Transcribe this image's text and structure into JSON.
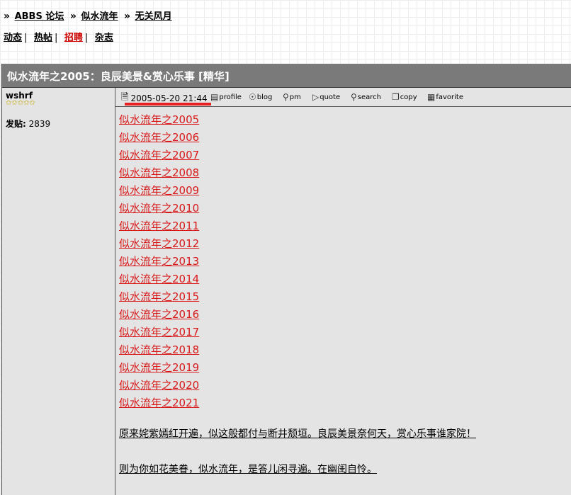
{
  "breadcrumb": {
    "sep": "»",
    "items": [
      "ABBS 论坛",
      "似水流年",
      "无关风月"
    ]
  },
  "topnav": {
    "items": [
      "动态",
      "热帖",
      "招聘",
      "杂志"
    ],
    "pipe": "|"
  },
  "thread": {
    "title": "似水流年之2005：良辰美景&赏心乐事   [精华]"
  },
  "author": {
    "name": "wshrf",
    "stars": "✩✩✩✩✩",
    "post_count_label": "发贴:",
    "post_count": "2839"
  },
  "post": {
    "date": "2005-05-20 21:44",
    "actions": {
      "profile": "profile",
      "blog": "blog",
      "pm": "pm",
      "quote": "quote",
      "search": "search",
      "copy": "copy",
      "favorite": "favorite"
    },
    "links": [
      "似水流年之2005",
      "似水流年之2006",
      "似水流年之2007",
      "似水流年之2008",
      "似水流年之2009",
      "似水流年之2010",
      "似水流年之2011",
      "似水流年之2012",
      "似水流年之2013",
      "似水流年之2014",
      "似水流年之2015",
      "似水流年之2016",
      "似水流年之2017",
      "似水流年之2018",
      "似水流年之2019",
      "似水流年之2020",
      "似水流年之2021"
    ],
    "para1": "原来姹紫嫣红开遍，似这般都付与断井颓垣。良辰美景奈何天，赏心乐事谁家院！",
    "para2": "则为你如花美眷，似水流年，是答儿闲寻遍。在幽闺自怜。"
  },
  "colors": {
    "header_bg": "#7a7a7a",
    "panel_bg": "#e4e4e4",
    "link_red": "#d81818",
    "hot_red": "#cc0000"
  },
  "icons": {
    "date": "post-icon",
    "profile": "profile-icon",
    "blog": "blog-icon",
    "pm": "pm-icon",
    "quote": "quote-icon",
    "search": "search-icon",
    "copy": "copy-icon",
    "favorite": "favorite-icon"
  }
}
